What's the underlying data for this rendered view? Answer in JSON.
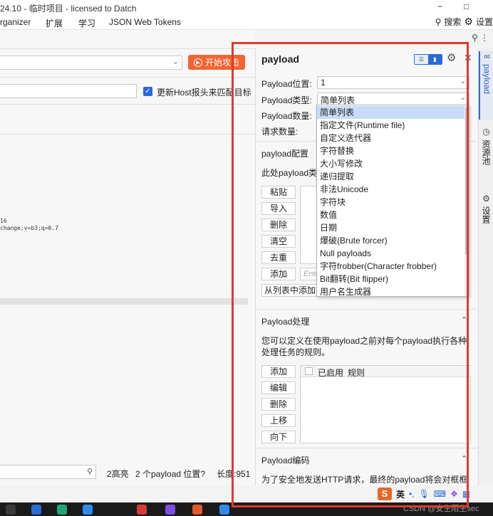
{
  "window": {
    "title": "24.10 - 临时项目 - licensed to Datch",
    "controls": [
      "−",
      "□"
    ]
  },
  "menubar": {
    "items": [
      "rganizer",
      "扩展",
      "学习",
      "JSON Web Tokens"
    ],
    "search_label": "搜索",
    "settings_label": "设置"
  },
  "left": {
    "start_attack": "开始攻击",
    "update_host_label": "更新Host报头来匹配目标",
    "code_lines": [
      "16",
      "change;v=b3;q=0.7"
    ],
    "status": {
      "highlights": "2高亮",
      "payload_positions": "2 个payload 位置?",
      "length": "长度:951"
    }
  },
  "panel": {
    "title": "payload",
    "payload_position_label": "Payload位置:",
    "payload_position_value": "1",
    "payload_type_label": "Payload类型:",
    "payload_type_value": "简单列表",
    "payload_count_label": "Payload数量:",
    "request_count_label": "请求数量:",
    "config_title": "payload配置",
    "config_desc": "此处payload类型",
    "config_buttons": [
      "粘贴",
      "导入",
      "删除",
      "清空",
      "去重",
      "添加"
    ],
    "add_placeholder": "Ente",
    "from_list": "从列表中添加...",
    "processing_title": "Payload处理",
    "processing_desc": "您可以定义在使用payload之前对每个payload执行各种处理任务的规则。",
    "processing_buttons": [
      "添加",
      "编辑",
      "删除",
      "上移",
      "向下"
    ],
    "rules_col_enabled": "已启用",
    "rules_col_rule": "规则",
    "encoding_title": "Payload编码",
    "encoding_desc": "为了安全地发送HTTP请求，最终的payload将会对框框内容"
  },
  "dropdown": {
    "options": [
      "简单列表",
      "指定文件(Runtime file)",
      "自定义迭代器",
      "字符替换",
      "大小写修改",
      "递归提取",
      "非法Unicode",
      "字符块",
      "数值",
      "日期",
      "爆破(Brute forcer)",
      "Null payloads",
      "字符frobber(Character frobber)",
      "Bit翻转(Bit flipper)",
      "用户名生成器"
    ],
    "selected_index": 0
  },
  "right_strip": {
    "tabs": [
      "payload",
      "资源池",
      "设置"
    ]
  },
  "ime": {
    "logo": "S",
    "lang": "英"
  },
  "watermark": "CSDN @安生陌生sec",
  "colors": {
    "accent": "#2a6ad8",
    "start_button": "#f26533",
    "annotation_red": "#e03a2e",
    "selected_option": "#c7dcf6"
  },
  "icons": {
    "search": "search-icon",
    "gear": "gear-icon",
    "close": "close-icon",
    "chevron_up": "chevron-up-icon",
    "chevron_down": "chevron-down-icon"
  }
}
